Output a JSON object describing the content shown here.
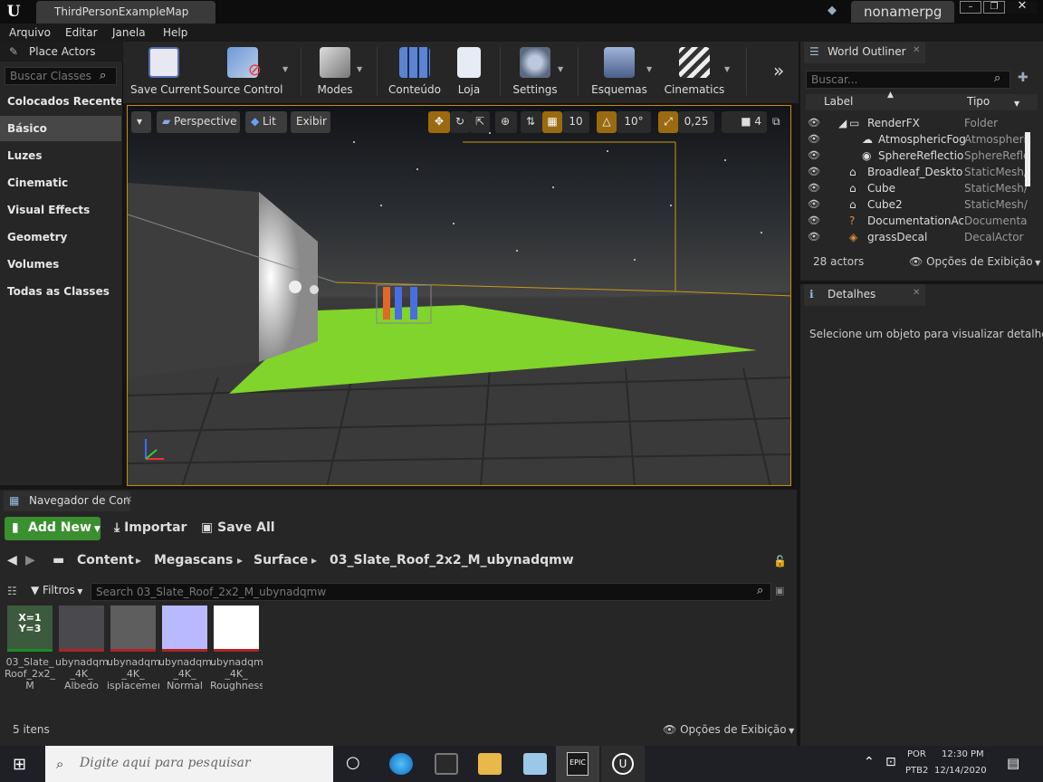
{
  "titlebar": {
    "map_tab": "ThirdPersonExampleMap",
    "user": "nonamerpg"
  },
  "menu": [
    "Arquivo",
    "Editar",
    "Janela",
    "Help"
  ],
  "place_actors": {
    "title": "Place Actors",
    "search_placeholder": "Buscar Classes",
    "categories": [
      "Colocados Recenteme",
      "Básico",
      "Luzes",
      "Cinematic",
      "Visual Effects",
      "Geometry",
      "Volumes",
      "Todas as Classes"
    ],
    "selected": "Básico"
  },
  "toolbar": [
    "Save Current",
    "Source Control",
    "Modes",
    "Conteúdo",
    "Loja",
    "Settings",
    "Esquemas",
    "Cinematics"
  ],
  "viewport": {
    "perspective": "Perspective",
    "lit": "Lit",
    "show": "Exibir",
    "grid_snap": "10",
    "rotation_snap": "10°",
    "scale_snap": "0,25",
    "camera_speed": "4"
  },
  "world_outliner": {
    "title": "World Outliner",
    "search_placeholder": "Buscar...",
    "col_label": "Label",
    "col_type": "Tipo",
    "rows": [
      {
        "label": "RenderFX",
        "type": "Folder",
        "indent": 1
      },
      {
        "label": "AtmosphericFog",
        "type": "Atmospheri",
        "indent": 2
      },
      {
        "label": "SphereReflection(",
        "type": "SphereRefle",
        "indent": 2
      },
      {
        "label": "Broadleaf_Desktop_",
        "type": "StaticMesh/",
        "indent": 1
      },
      {
        "label": "Cube",
        "type": "StaticMesh/",
        "indent": 1
      },
      {
        "label": "Cube2",
        "type": "StaticMesh/",
        "indent": 1
      },
      {
        "label": "DocumentationActo",
        "type": "Documenta",
        "indent": 1
      },
      {
        "label": "grassDecal",
        "type": "DecalActor",
        "indent": 1
      }
    ],
    "count": "28 actors",
    "view_options": "Opções de Exibição"
  },
  "details": {
    "title": "Detalhes",
    "message": "Selecione um objeto para visualizar detalhes."
  },
  "content_browser": {
    "title": "Navegador de Con",
    "add_new": "Add New",
    "import": "Importar",
    "save_all": "Save All",
    "breadcrumb": [
      "Content",
      "Megascans",
      "Surface",
      "03_Slate_Roof_2x2_M_ubynadqmw"
    ],
    "filters": "Filtros",
    "search_placeholder": "Search 03_Slate_Roof_2x2_M_ubynadqmw",
    "assets": [
      {
        "lines": [
          "03_Slate_",
          "Roof_2x2_",
          "M"
        ],
        "thumb": "#3c5a3c",
        "bar": "#1d8a2a",
        "glyph": "X=1\nY=3"
      },
      {
        "lines": [
          "ubynadqmw",
          "_4K_",
          "Albedo"
        ],
        "thumb": "#4a4a4e",
        "bar": "#b02323"
      },
      {
        "lines": [
          "ubynadqmw",
          "_4K_",
          "isplacemer"
        ],
        "thumb": "#5e5e5e",
        "bar": "#b02323"
      },
      {
        "lines": [
          "ubynadqmw",
          "_4K_",
          "Normal"
        ],
        "thumb": "#b9b9ff",
        "bar": "#b02323"
      },
      {
        "lines": [
          "ubynadqmw",
          "_4K_",
          "Roughness"
        ],
        "thumb": "#ffffff",
        "bar": "#b02323"
      }
    ],
    "item_count": "5 itens",
    "view_options": "Opções de Exibição"
  },
  "taskbar": {
    "search_placeholder": "Digite aqui para pesquisar",
    "lang1": "POR",
    "lang2": "PTB2",
    "time": "12:30 PM",
    "date": "12/14/2020"
  }
}
